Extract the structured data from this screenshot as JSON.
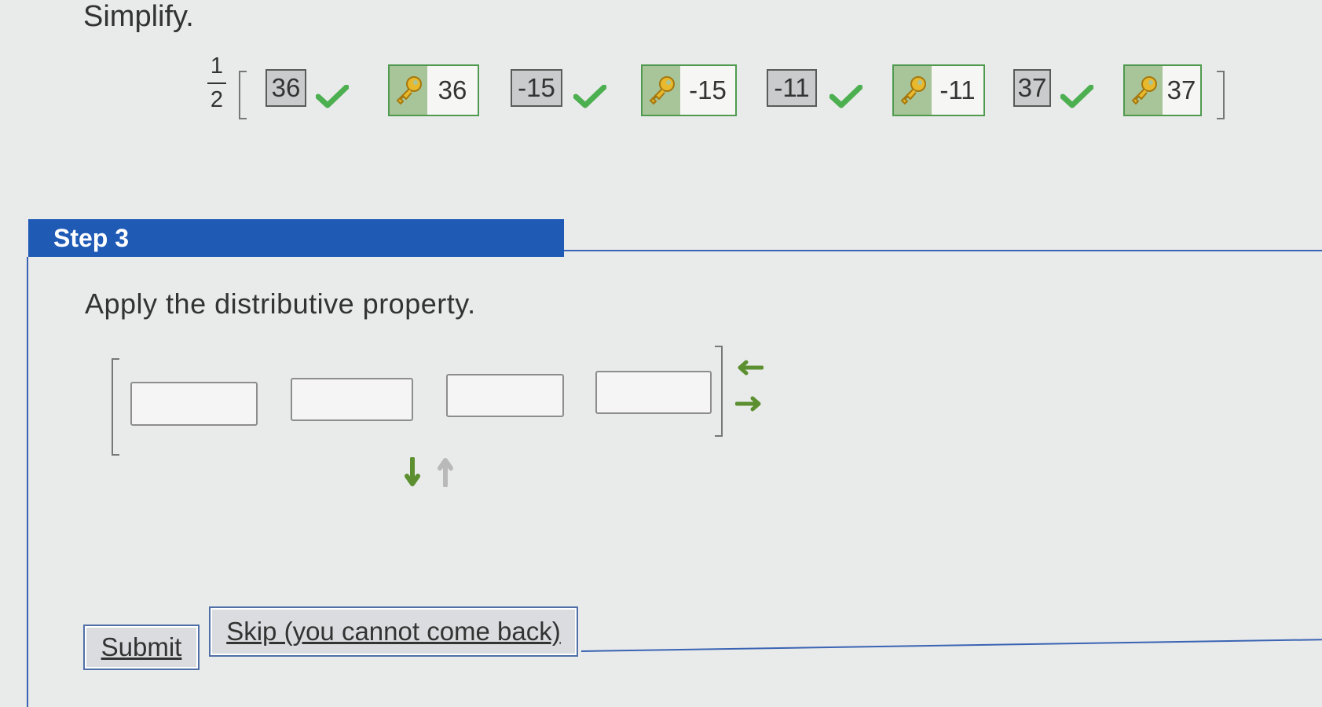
{
  "problem": {
    "title": "Simplify.",
    "fraction": {
      "numerator": "1",
      "denominator": "2"
    },
    "items": [
      {
        "entered": "36",
        "answer": "36"
      },
      {
        "entered": "-15",
        "answer": "-15"
      },
      {
        "entered": "-11",
        "answer": "-11"
      },
      {
        "entered": "37",
        "answer": "37"
      }
    ],
    "icons": {
      "correct": "check-icon",
      "answer": "key-icon"
    },
    "colors": {
      "correct": "#4caf50",
      "key_border": "#4f9a4f",
      "key_fill": "#a8c59a"
    }
  },
  "step": {
    "label": "Step 3",
    "instruction": "Apply the distributive property.",
    "inputs": [
      "",
      "",
      "",
      ""
    ],
    "colors": {
      "header": "#1f5ab5",
      "arrows": "#5c8f2f"
    }
  },
  "buttons": {
    "submit": "Submit",
    "skip": "Skip (you cannot come back)"
  }
}
